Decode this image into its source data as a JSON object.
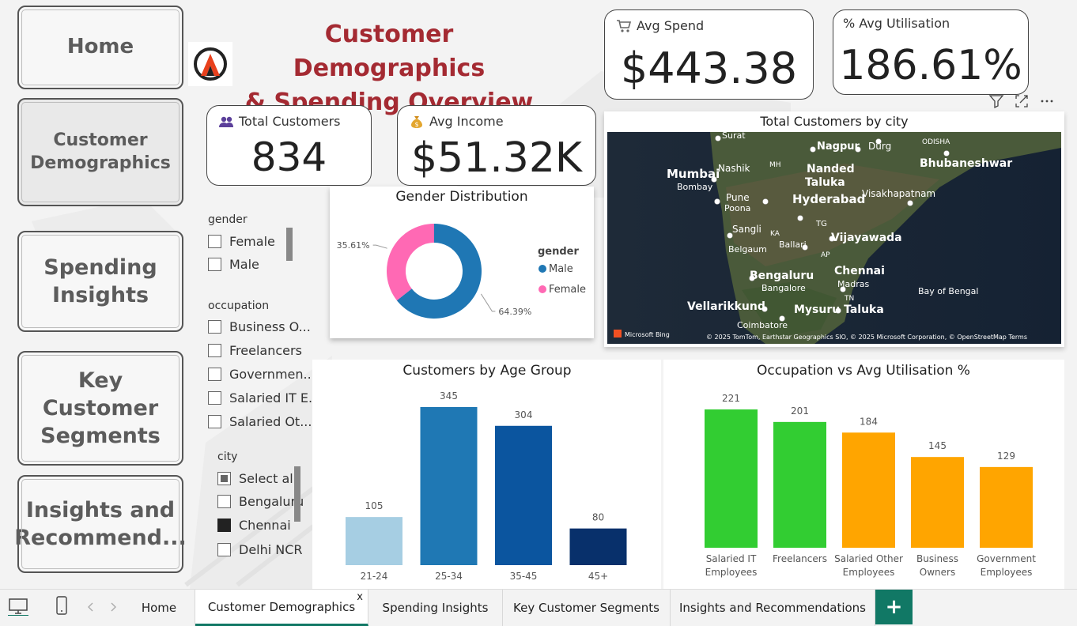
{
  "nav": {
    "home": "Home",
    "customer_demo_1": "Customer",
    "customer_demo_2": "Demographics",
    "spending_1": "Spending",
    "spending_2": "Insights",
    "segments_1": "Key Customer",
    "segments_2": "Segments",
    "insights_1": "Insights and",
    "insights_2": "Recommend..."
  },
  "header": {
    "title_line1": "Customer Demographics",
    "title_line2": "& Spending Overview"
  },
  "kpis": {
    "avg_spend": {
      "label": "Avg Spend",
      "value": "$443.38",
      "icon": "shopping-cart-icon"
    },
    "avg_utilisation": {
      "label": "% Avg Utilisation",
      "value": "186.61%"
    },
    "total_customers": {
      "label": "Total Customers",
      "value": "834",
      "icon": "people-icon"
    },
    "avg_income": {
      "label": "Avg Income",
      "value": "$51.32K",
      "icon": "money-bag-icon"
    }
  },
  "slicers": {
    "gender": {
      "title": "gender",
      "items": [
        "Female",
        "Male"
      ]
    },
    "occupation": {
      "title": "occupation",
      "items": [
        "Business O...",
        "Freelancers",
        "Governmen...",
        "Salaried IT E...",
        "Salaried Ot..."
      ]
    },
    "city": {
      "title": "city",
      "items": [
        "Select all",
        "Bengaluru",
        "Chennai",
        "Delhi NCR"
      ],
      "states": [
        "partial",
        "empty",
        "filled",
        "empty"
      ]
    }
  },
  "map": {
    "title": "Total Customers by city",
    "labels": [
      "Surat",
      "Nagpur",
      "Durg",
      "ODISHA",
      "Mumbai",
      "Bombay",
      "Nashik",
      "MH",
      "Nanded",
      "Taluka",
      "Bhubaneshwar",
      "Pune",
      "Poona",
      "Hyderabad",
      "Visakhapatnam",
      "TG",
      "Sangli",
      "KA",
      "Ballari",
      "Belgaum",
      "AP",
      "Vijayawada",
      "Bengaluru",
      "Bangalore",
      "Chennai",
      "Madras",
      "Bay of Bengal",
      "Vellarikkund",
      "Mysuru Taluka",
      "TN",
      "Coimbatore"
    ],
    "bing": "Microsoft Bing",
    "attribution": "© 2025 TomTom, Earthstar Geographics SIO, © 2025 Microsoft Corporation, © OpenStreetMap  Terms"
  },
  "visual_header_icons": [
    "filter-icon",
    "focus-mode-icon",
    "more-options-icon"
  ],
  "tabs": [
    "Home",
    "Customer Demographics",
    "Spending Insights",
    "Key Customer Segments",
    "Insights and Recommendations"
  ],
  "tab_close": "x",
  "add_tab": "+",
  "chart_data": [
    {
      "type": "pie",
      "title": "Gender Distribution",
      "legend_title": "gender",
      "legend_position": "right",
      "categories": [
        "Male",
        "Female"
      ],
      "values": [
        64.39,
        35.61
      ],
      "data_labels": [
        "64.39%",
        "35.61%"
      ],
      "colors": [
        "#1f77b4",
        "#ff69b4"
      ]
    },
    {
      "type": "bar",
      "title": "Customers by Age Group",
      "categories": [
        "21-24",
        "25-34",
        "35-45",
        "45+"
      ],
      "values": [
        105,
        345,
        304,
        80
      ],
      "colors": [
        "#a6cee3",
        "#1f78b4",
        "#0b559f",
        "#08306b"
      ],
      "ylim": [
        0,
        345
      ]
    },
    {
      "type": "bar",
      "title": "Occupation vs Avg Utilisation %",
      "categories": [
        "Salaried IT Employees",
        "Freelancers",
        "Salaried Other Employees",
        "Business Owners",
        "Government Employees"
      ],
      "values": [
        221,
        201,
        184,
        145,
        129
      ],
      "colors": [
        "#32cd32",
        "#32cd32",
        "#ffa500",
        "#ffa500",
        "#ffa500"
      ],
      "ylim": [
        0,
        221
      ]
    }
  ]
}
